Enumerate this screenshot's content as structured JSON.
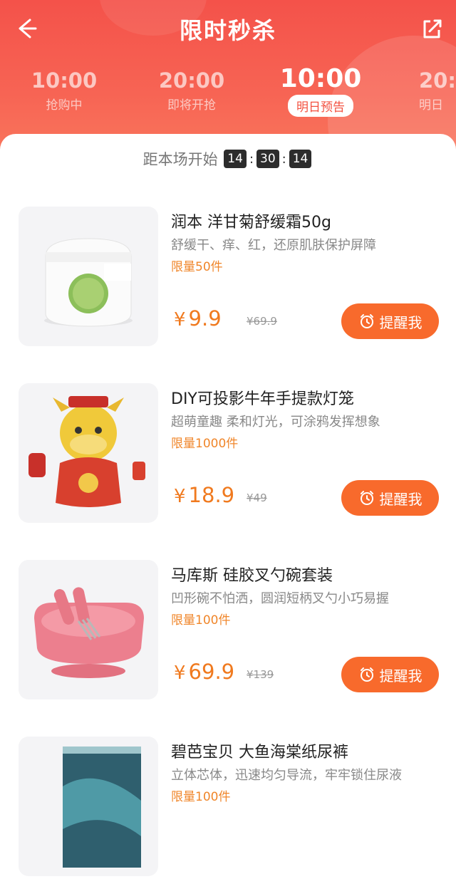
{
  "header": {
    "title": "限时秒杀",
    "back_icon": "back-arrow-icon",
    "share_icon": "share-icon"
  },
  "sessions": [
    {
      "time": "10:00",
      "label": "抢购中"
    },
    {
      "time": "20:00",
      "label": "即将开抢"
    },
    {
      "time": "10:00",
      "label": "明日预告",
      "active": true
    },
    {
      "time": "20:",
      "label": "明日"
    }
  ],
  "countdown": {
    "label": "距本场开始",
    "hours": "14",
    "minutes": "30",
    "seconds": "14"
  },
  "products": [
    {
      "name": "润本 洋甘菊舒缓霜50g",
      "desc": "舒缓干、痒、红，还原肌肤保护屏障",
      "limit": "限量50件",
      "currency": "¥",
      "price": "9.9",
      "original_price": "¥69.9",
      "button": "提醒我"
    },
    {
      "name": "DIY可投影牛年手提款灯笼",
      "desc": "超萌童趣 柔和灯光，可涂鸦发挥想象",
      "limit": "限量1000件",
      "currency": "¥",
      "price": "18.9",
      "original_price": "¥49",
      "button": "提醒我"
    },
    {
      "name": "马库斯 硅胶叉勺碗套装",
      "desc": "凹形碗不怕洒，圆润短柄叉勺小巧易握",
      "limit": "限量100件",
      "currency": "¥",
      "price": "69.9",
      "original_price": "¥139",
      "button": "提醒我"
    },
    {
      "name": "碧芭宝贝 大鱼海棠纸尿裤",
      "desc": "立体芯体，迅速均匀导流，牢牢锁住尿液",
      "limit": "限量100件"
    }
  ],
  "colors": {
    "header_red": "#f4524a",
    "accent_orange": "#f86a2c",
    "price_orange": "#f07a1f"
  }
}
